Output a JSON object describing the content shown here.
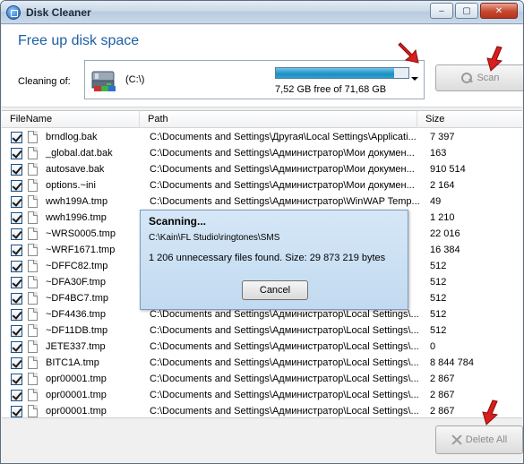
{
  "window": {
    "title": "Disk Cleaner",
    "minimize": "–",
    "maximize": "▢",
    "close": "✕"
  },
  "header": {
    "title": "Free up disk space",
    "cleaning_label": "Cleaning of:",
    "drive": {
      "name": "(C:\\)",
      "free_text": "7,52 GB free of 71,68 GB",
      "used_fraction": 0.895
    },
    "scan_label": "Scan"
  },
  "table": {
    "columns": {
      "name": "FileName",
      "path": "Path",
      "size": "Size"
    },
    "rows": [
      {
        "name": "brndlog.bak",
        "path": "C:\\Documents and Settings\\Другая\\Local Settings\\Applicati...",
        "size": "7 397"
      },
      {
        "name": "_global.dat.bak",
        "path": "C:\\Documents and Settings\\Администратор\\Мои докумен...",
        "size": "163"
      },
      {
        "name": "autosave.bak",
        "path": "C:\\Documents and Settings\\Администратор\\Мои докумен...",
        "size": "910 514"
      },
      {
        "name": "options.~ini",
        "path": "C:\\Documents and Settings\\Администратор\\Мои докумен...",
        "size": "2 164"
      },
      {
        "name": "wwh199A.tmp",
        "path": "C:\\Documents and Settings\\Администратор\\WinWAP Temp...",
        "size": "49"
      },
      {
        "name": "wwh1996.tmp",
        "path": "",
        "size": "1 210"
      },
      {
        "name": "~WRS0005.tmp",
        "path": "",
        "size": "22 016"
      },
      {
        "name": "~WRF1671.tmp",
        "path": "",
        "size": "16 384"
      },
      {
        "name": "~DFFC82.tmp",
        "path": "",
        "size": "512"
      },
      {
        "name": "~DFA30F.tmp",
        "path": "",
        "size": "512"
      },
      {
        "name": "~DF4BC7.tmp",
        "path": "",
        "size": "512"
      },
      {
        "name": "~DF4436.tmp",
        "path": "C:\\Documents and Settings\\Администратор\\Local Settings\\...",
        "size": "512"
      },
      {
        "name": "~DF11DB.tmp",
        "path": "C:\\Documents and Settings\\Администратор\\Local Settings\\...",
        "size": "512"
      },
      {
        "name": "JETE337.tmp",
        "path": "C:\\Documents and Settings\\Администратор\\Local Settings\\...",
        "size": "0"
      },
      {
        "name": "BITC1A.tmp",
        "path": "C:\\Documents and Settings\\Администратор\\Local Settings\\...",
        "size": "8 844 784"
      },
      {
        "name": "opr00001.tmp",
        "path": "C:\\Documents and Settings\\Администратор\\Local Settings\\...",
        "size": "2 867"
      },
      {
        "name": "opr00001.tmp",
        "path": "C:\\Documents and Settings\\Администратор\\Local Settings\\...",
        "size": "2 867"
      },
      {
        "name": "opr00001.tmp",
        "path": "C:\\Documents and Settings\\Администратор\\Local Settings\\...",
        "size": "2 867"
      }
    ]
  },
  "dialog": {
    "title": "Scanning...",
    "path": "C:\\Kain\\FL Studio\\ringtones\\SMS",
    "message": "1 206 unnecessary files found. Size: 29 873 219 bytes",
    "cancel_label": "Cancel"
  },
  "footer": {
    "delete_label": "Delete All"
  },
  "colors": {
    "accent": "#1d5fa6",
    "progress": "#1f8fc0",
    "arrow": "#d81e1e"
  }
}
